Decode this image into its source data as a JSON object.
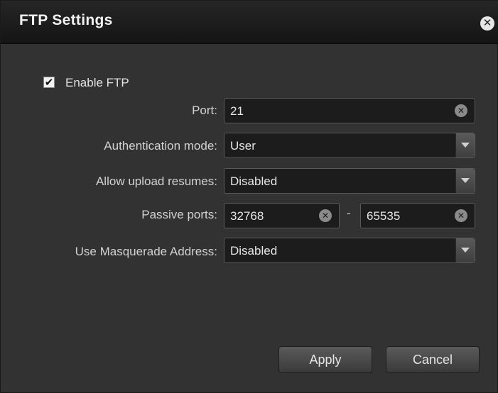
{
  "dialog": {
    "title": "FTP Settings",
    "close_icon": "✕"
  },
  "enable_ftp": {
    "label": "Enable FTP",
    "checked": true,
    "check_glyph": "✔"
  },
  "port": {
    "label": "Port:",
    "value": "21"
  },
  "auth_mode": {
    "label": "Authentication mode:",
    "selected": "User"
  },
  "upload_resumes": {
    "label": "Allow upload resumes:",
    "selected": "Disabled"
  },
  "passive_ports": {
    "label": "Passive ports:",
    "from": "32768",
    "separator": "-",
    "to": "65535"
  },
  "masquerade": {
    "label": "Use Masquerade Address:",
    "selected": "Disabled"
  },
  "buttons": {
    "apply": "Apply",
    "cancel": "Cancel"
  },
  "colors": {
    "title_bar": "#141414",
    "body": "#323232",
    "field_bg": "#1c1c1c"
  }
}
